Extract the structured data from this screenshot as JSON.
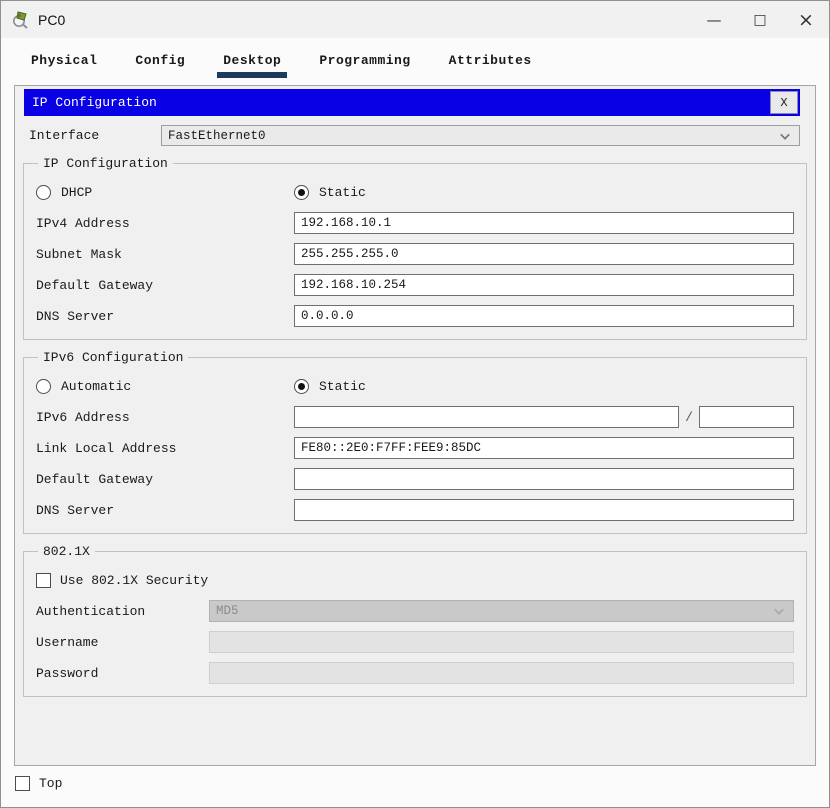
{
  "window": {
    "title": "PC0"
  },
  "icons": {
    "app": "packet-tracer-magnifier-icon",
    "minimize": "—",
    "maximize": "□",
    "close": "×",
    "dropdown_chevron": "chevron-down"
  },
  "tabs": [
    {
      "label": "Physical",
      "active": false
    },
    {
      "label": "Config",
      "active": false
    },
    {
      "label": "Desktop",
      "active": true
    },
    {
      "label": "Programming",
      "active": false
    },
    {
      "label": "Attributes",
      "active": false
    }
  ],
  "dialog": {
    "title": "IP Configuration",
    "close_label": "X"
  },
  "interface": {
    "label": "Interface",
    "value": "FastEthernet0"
  },
  "ip_config": {
    "legend": "IP Configuration",
    "radio_dhcp": {
      "label": "DHCP",
      "checked": false
    },
    "radio_static": {
      "label": "Static",
      "checked": true
    },
    "fields": [
      {
        "label": "IPv4 Address",
        "value": "192.168.10.1"
      },
      {
        "label": "Subnet Mask",
        "value": "255.255.255.0"
      },
      {
        "label": "Default Gateway",
        "value": "192.168.10.254"
      },
      {
        "label": "DNS Server",
        "value": "0.0.0.0"
      }
    ]
  },
  "ipv6_config": {
    "legend": "IPv6 Configuration",
    "radio_automatic": {
      "label": "Automatic",
      "checked": false
    },
    "radio_static": {
      "label": "Static",
      "checked": true
    },
    "ipv6_address": {
      "label": "IPv6 Address",
      "value": "",
      "separator": "/",
      "prefix": ""
    },
    "fields": [
      {
        "label": "Link Local Address",
        "value": "FE80::2E0:F7FF:FEE9:85DC"
      },
      {
        "label": "Default Gateway",
        "value": ""
      },
      {
        "label": "DNS Server",
        "value": ""
      }
    ]
  },
  "dot1x": {
    "legend": "802.1X",
    "security_checkbox": {
      "label": "Use 802.1X Security",
      "checked": false
    },
    "authentication": {
      "label": "Authentication",
      "value": "MD5",
      "disabled": true
    },
    "username": {
      "label": "Username",
      "value": "",
      "disabled": true
    },
    "password": {
      "label": "Password",
      "value": "",
      "disabled": true
    }
  },
  "footer": {
    "top_checkbox": {
      "label": "Top",
      "checked": false
    }
  },
  "colors": {
    "dialog_header": "#0a00e6",
    "active_tab_underline": "#1b3a5e",
    "panel_background": "#f0f0f0",
    "disabled_field": "#e3e3e3",
    "disabled_dropdown": "#c9c9c9"
  }
}
